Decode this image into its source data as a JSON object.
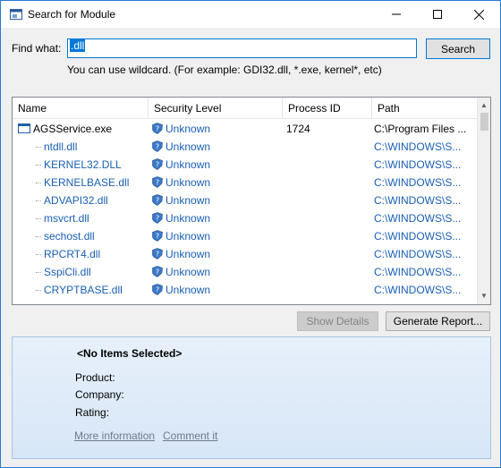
{
  "window": {
    "title": "Search for Module"
  },
  "search": {
    "find_label": "Find what:",
    "value": ".dll",
    "button": "Search",
    "hint": "You can use wildcard. (For example: GDI32.dll, *.exe, kernel*, etc)"
  },
  "list": {
    "columns": [
      "Name",
      "Security Level",
      "Process ID",
      "Path"
    ],
    "rows": [
      {
        "name": "AGSService.exe",
        "security": "Unknown",
        "pid": "1724",
        "path": "C:\\Program Files ..."
      },
      {
        "name": "ntdll.dll",
        "security": "Unknown",
        "pid": "",
        "path": "C:\\WINDOWS\\S..."
      },
      {
        "name": "KERNEL32.DLL",
        "security": "Unknown",
        "pid": "",
        "path": "C:\\WINDOWS\\S..."
      },
      {
        "name": "KERNELBASE.dll",
        "security": "Unknown",
        "pid": "",
        "path": "C:\\WINDOWS\\S..."
      },
      {
        "name": "ADVAPI32.dll",
        "security": "Unknown",
        "pid": "",
        "path": "C:\\WINDOWS\\S..."
      },
      {
        "name": "msvcrt.dll",
        "security": "Unknown",
        "pid": "",
        "path": "C:\\WINDOWS\\S..."
      },
      {
        "name": "sechost.dll",
        "security": "Unknown",
        "pid": "",
        "path": "C:\\WINDOWS\\S..."
      },
      {
        "name": "RPCRT4.dll",
        "security": "Unknown",
        "pid": "",
        "path": "C:\\WINDOWS\\S..."
      },
      {
        "name": "SspiCli.dll",
        "security": "Unknown",
        "pid": "",
        "path": "C:\\WINDOWS\\S..."
      },
      {
        "name": "CRYPTBASE.dll",
        "security": "Unknown",
        "pid": "",
        "path": "C:\\WINDOWS\\S..."
      }
    ]
  },
  "buttons": {
    "show_details": "Show Details",
    "generate_report": "Generate Report..."
  },
  "details": {
    "title": "<No Items Selected>",
    "product_label": "Product:",
    "company_label": "Company:",
    "rating_label": "Rating:",
    "more_info": "More information",
    "comment": "Comment it"
  },
  "colors": {
    "accent": "#0078d7",
    "link": "#1a5fb4",
    "panel": "#dce9f8"
  },
  "icons": {
    "app": "window-search-icon",
    "exe": "executable-icon",
    "security": "shield-icon"
  }
}
